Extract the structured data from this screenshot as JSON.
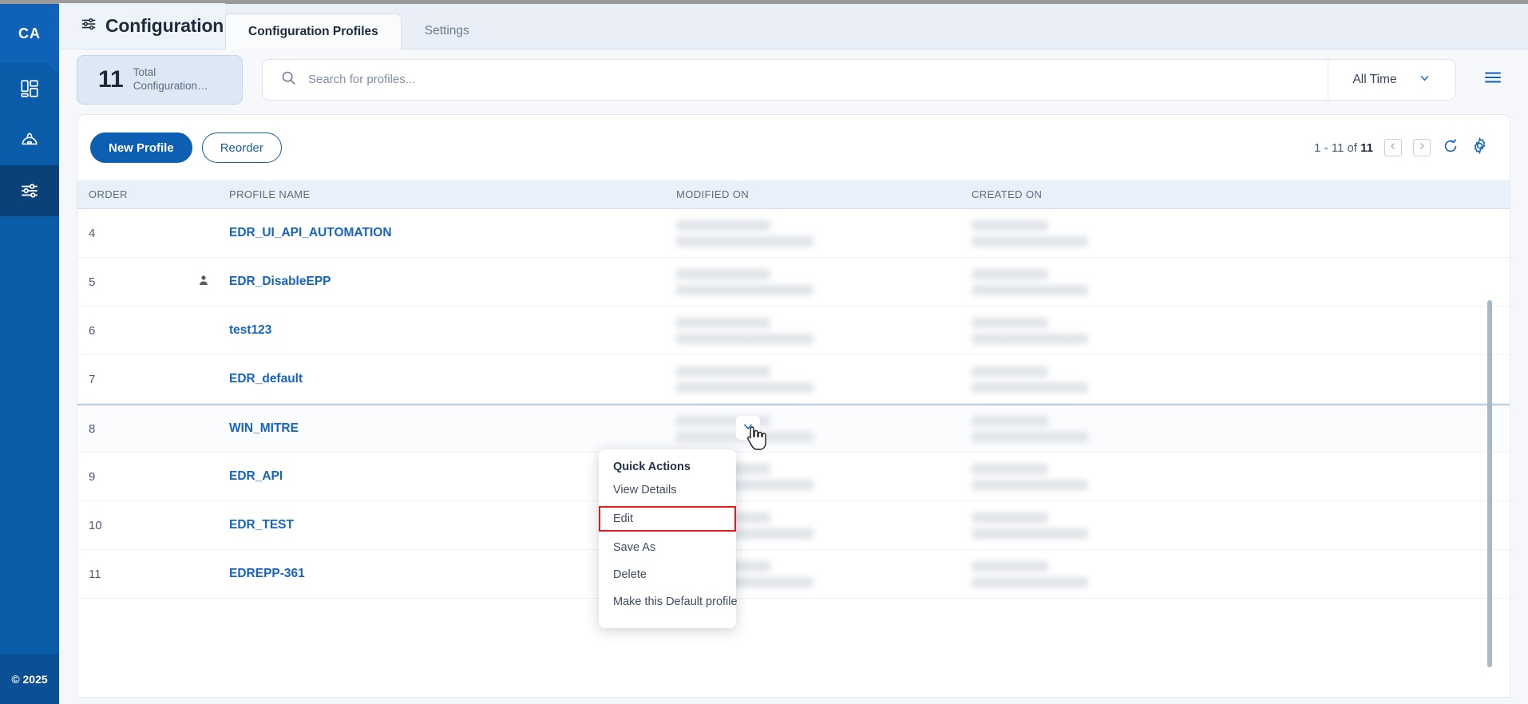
{
  "sidebar": {
    "logo_text": "CA",
    "items": [
      {
        "name": "dashboard",
        "icon": "dashboard-icon"
      },
      {
        "name": "deploy",
        "icon": "deploy-icon"
      },
      {
        "name": "configuration",
        "icon": "sliders-icon",
        "active": true
      }
    ],
    "footer_text": "© 2025"
  },
  "header": {
    "title": "Configuration",
    "title_icon": "sliders-icon",
    "tabs": [
      {
        "label": "Configuration Profiles",
        "active": true
      },
      {
        "label": "Settings",
        "active": false
      }
    ]
  },
  "filters": {
    "stat": {
      "number": "11",
      "label": "Total Configuration…"
    },
    "search": {
      "placeholder": "Search for profiles...",
      "value": "",
      "icon": "search-icon"
    },
    "time_range": {
      "selected": "All Time",
      "icon": "chevron-down-icon"
    },
    "menu_icon": "hamburger-icon"
  },
  "toolbar": {
    "new_profile_label": "New Profile",
    "reorder_label": "Reorder",
    "pager_prefix": "1 - 11 of",
    "pager_total": "11",
    "prev_icon": "chevron-left-icon",
    "next_icon": "chevron-right-icon",
    "refresh_icon": "refresh-icon",
    "settings_icon": "gear-icon"
  },
  "table": {
    "columns": [
      "ORDER",
      "PROFILE NAME",
      "MODIFIED ON",
      "CREATED ON"
    ],
    "rows": [
      {
        "order": "4",
        "name": "EDR_UI_API_AUTOMATION",
        "has_user_icon": false,
        "selected": false,
        "modified_redacted": true,
        "created_redacted": true
      },
      {
        "order": "5",
        "name": "EDR_DisableEPP",
        "has_user_icon": true,
        "selected": false,
        "modified_redacted": true,
        "created_redacted": true
      },
      {
        "order": "6",
        "name": "test123",
        "has_user_icon": false,
        "selected": false,
        "modified_redacted": true,
        "created_redacted": true
      },
      {
        "order": "7",
        "name": "EDR_default",
        "has_user_icon": false,
        "selected": false,
        "modified_redacted": true,
        "created_redacted": true
      },
      {
        "order": "8",
        "name": "WIN_MITRE",
        "has_user_icon": false,
        "selected": true,
        "modified_redacted": true,
        "created_redacted": true
      },
      {
        "order": "9",
        "name": "EDR_API",
        "has_user_icon": false,
        "selected": false,
        "modified_redacted": true,
        "created_redacted": true
      },
      {
        "order": "10",
        "name": "EDR_TEST",
        "has_user_icon": false,
        "selected": false,
        "modified_redacted": true,
        "created_redacted": true
      },
      {
        "order": "11",
        "name": "EDREPP-361",
        "has_user_icon": false,
        "selected": false,
        "modified_redacted": true,
        "created_redacted": true
      }
    ]
  },
  "quick_actions": {
    "title": "Quick Actions",
    "items": [
      {
        "label": "View Details",
        "highlighted": false
      },
      {
        "label": "Edit",
        "highlighted": true
      },
      {
        "label": "Save As",
        "highlighted": false
      },
      {
        "label": "Delete",
        "highlighted": false
      },
      {
        "label": "Make this Default profile",
        "highlighted": false
      }
    ],
    "trigger_icon": "chevron-down-icon"
  },
  "colors": {
    "brand_blue": "#0a5ba8",
    "primary_button": "#0d5fb3",
    "link_blue": "#1565c0",
    "highlight_red": "#e01b1b",
    "header_bg": "#eaeff7",
    "table_head_bg": "#eaf0f9"
  }
}
